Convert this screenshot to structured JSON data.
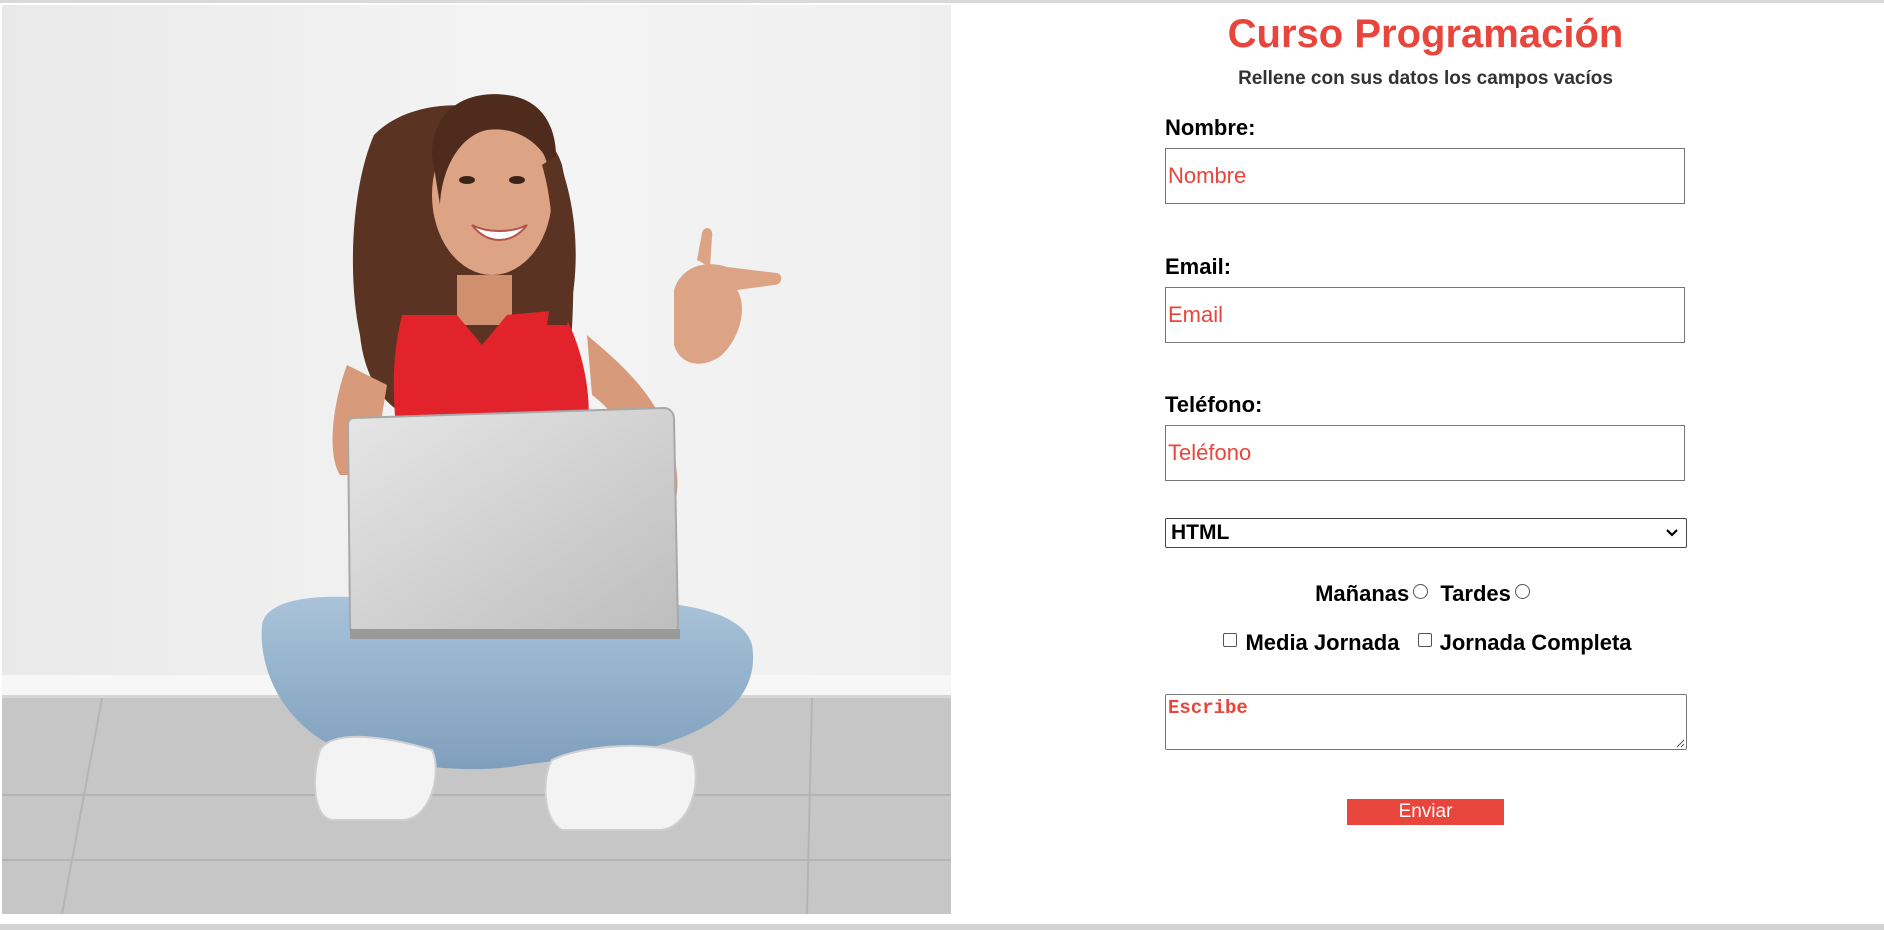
{
  "form": {
    "title": "Curso Programación",
    "subtitle": "Rellene con sus datos los campos vacíos",
    "fields": {
      "nombre": {
        "label": "Nombre:",
        "placeholder": "Nombre"
      },
      "email": {
        "label": "Email:",
        "placeholder": "Email"
      },
      "telefono": {
        "label": "Teléfono:",
        "placeholder": "Teléfono"
      }
    },
    "course_select": {
      "selected": "HTML"
    },
    "schedule": {
      "option_1": "Mañanas",
      "option_2": "Tardes"
    },
    "workload": {
      "option_1": "Media Jornada",
      "option_2": "Jornada Completa"
    },
    "comments": {
      "placeholder": "Escribe"
    },
    "submit_label": "Enviar"
  },
  "image": {
    "description_icon": "woman-with-laptop-photo"
  },
  "colors": {
    "accent": "#e8453c",
    "subtitle": "#333333"
  }
}
